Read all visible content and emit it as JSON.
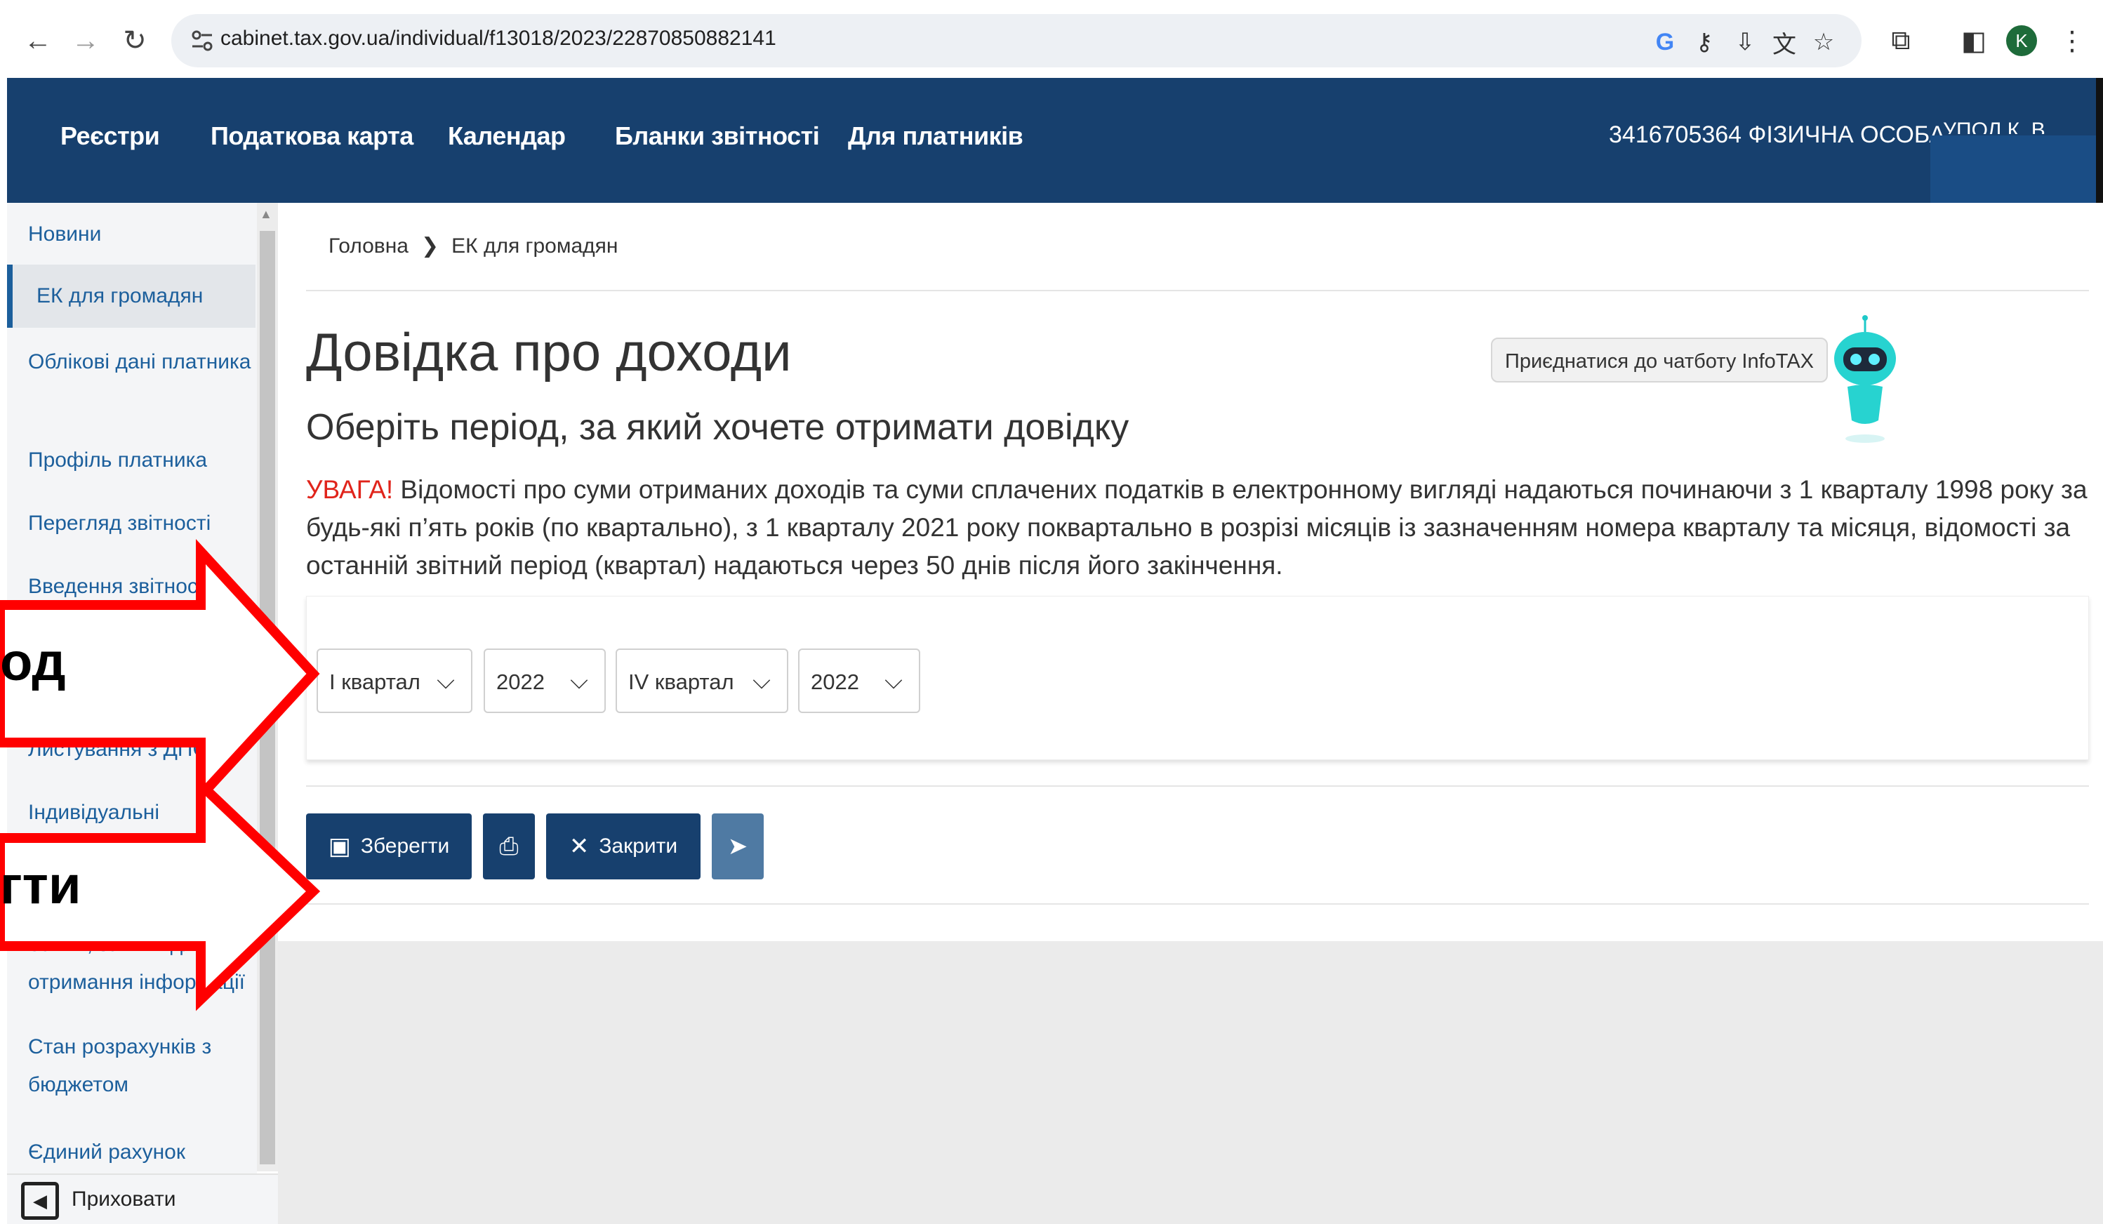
{
  "browser": {
    "url": "cabinet.tax.gov.ua/individual/f13018/2023/22870850882141",
    "profile_initial": "K"
  },
  "header": {
    "nav": [
      "Реєстри",
      "Податкова карта",
      "Календар",
      "Бланки звітності",
      "Для платників"
    ],
    "taxpayer": "3416705364 ФІЗИЧНА ОСОБА",
    "user": "УПОЛ К. В."
  },
  "sidebar": {
    "items": [
      {
        "label": "Новини"
      },
      {
        "label": "ЕК для громадян"
      },
      {
        "label": "Облікові дані платника"
      },
      {
        "label": "Профіль платника"
      },
      {
        "label": "Перегляд звітності"
      },
      {
        "label": "Введення звітності"
      },
      {
        "label": "Листування з ДПС"
      },
      {
        "label": "Індивідуальні"
      },
      {
        "label": "Заяви, запити для отримання інформації"
      },
      {
        "label": "Стан розрахунків з бюджетом"
      },
      {
        "label": "Єдиний рахунок"
      }
    ],
    "hide_label": "Приховати"
  },
  "breadcrumb": {
    "home": "Головна",
    "current": "ЕК для громадян"
  },
  "page": {
    "title": "Довідка про доходи",
    "subtitle": "Оберіть період, за який хочете отримати довідку",
    "warning_word": "УВАГА!",
    "warning_text": " Відомості про суми отриманих доходів та суми сплачених податків в електронному вигляді надаються починаючи з 1 кварталу 1998 року за будь-які п’ять років (по квартально), з 1 кварталу 2021 року поквартально в розрізі місяців із зазначенням номера кварталу та місяця, відомості за останній звітний період (квартал) надаються через 50 днів після його закінчення."
  },
  "chatbot": {
    "label": "Приєднатися до чатботу InfoTAX"
  },
  "filters": {
    "from_quarter": "І квартал",
    "from_year": "2022",
    "to_quarter": "IV квартал",
    "to_year": "2022"
  },
  "buttons": {
    "save": "Зберегти",
    "close": "Закрити"
  },
  "overlay": {
    "text1": "од",
    "text2": "гти"
  },
  "colors": {
    "header_bg": "#17406e",
    "link": "#1c5f9c",
    "warning": "#e0241b",
    "annotation": "#ff0000"
  }
}
